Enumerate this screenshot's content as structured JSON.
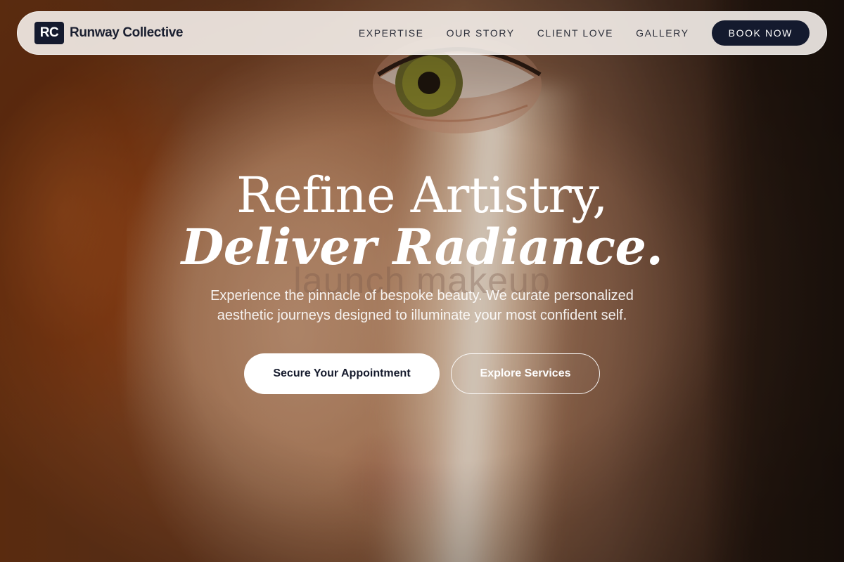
{
  "nav": {
    "brand_mark": "RC",
    "brand_name": "Runway Collective",
    "links": [
      "EXPERTISE",
      "OUR STORY",
      "CLIENT LOVE",
      "GALLERY"
    ],
    "cta_label": "BOOK NOW"
  },
  "hero": {
    "headline_line1": "Refine Artistry,",
    "headline_line2": "Deliver Radiance.",
    "watermark": "launch makeup",
    "subtitle": "Experience the pinnacle of bespoke beauty. We curate personalized aesthetic journeys designed to illuminate your most confident self.",
    "primary_cta": "Secure Your Appointment",
    "secondary_cta": "Explore Services"
  },
  "colors": {
    "brand_navy": "#141a2e",
    "nav_bg": "#f4eeea",
    "text_white": "#ffffff"
  }
}
